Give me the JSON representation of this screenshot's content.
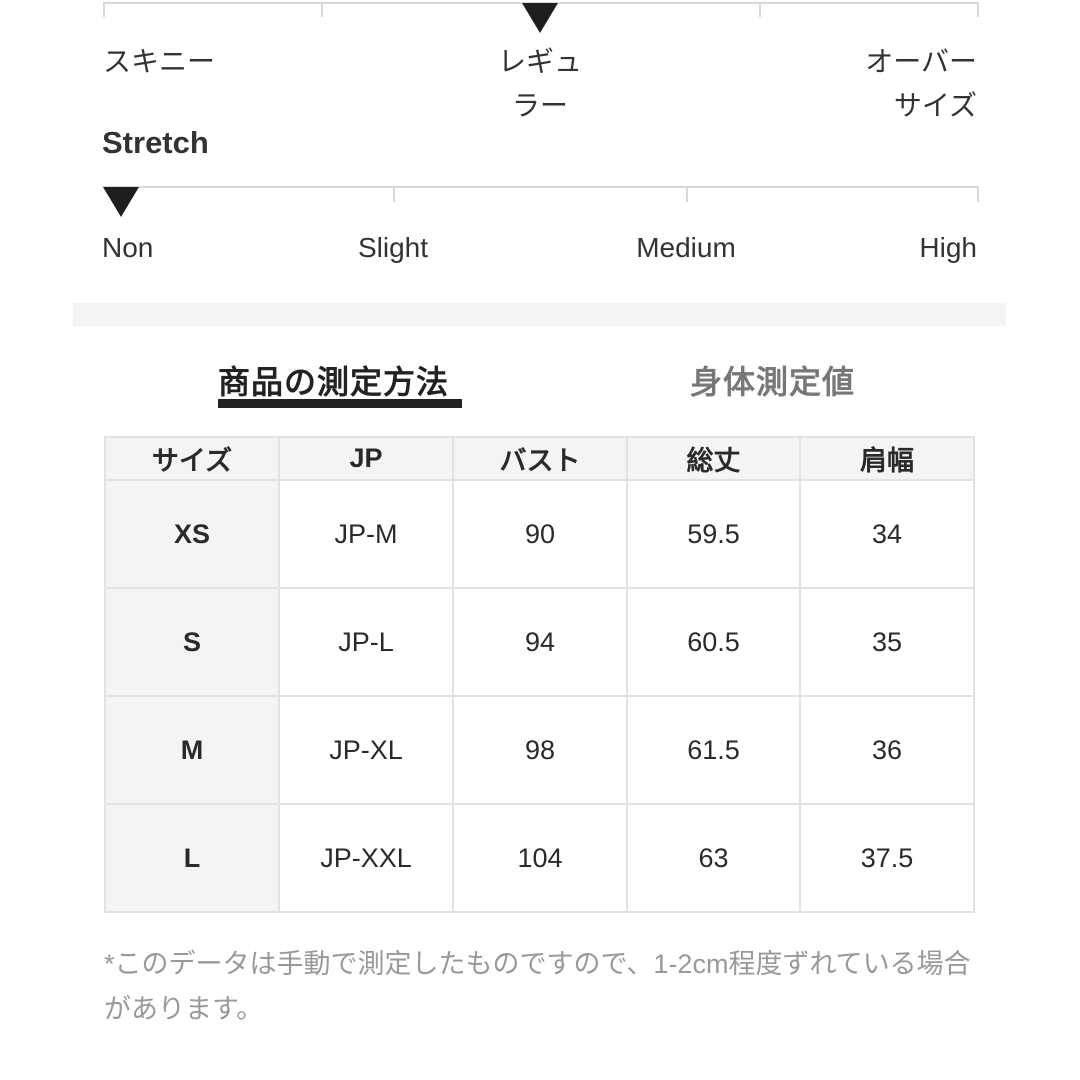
{
  "fit_scale": {
    "labels": [
      "スキニー",
      "レギュラー",
      "オーバーサイズ"
    ],
    "label_lines": [
      [
        "スキニー"
      ],
      [
        "レギュ",
        "ラー"
      ],
      [
        "オーバー",
        "サイズ"
      ]
    ],
    "selected_index": 1
  },
  "stretch_scale": {
    "title": "Stretch",
    "labels": [
      "Non",
      "Slight",
      "Medium",
      "High"
    ],
    "selected_index": 0
  },
  "tabs": [
    {
      "label": "商品の測定方法",
      "active": true
    },
    {
      "label": "身体測定値",
      "active": false
    }
  ],
  "size_table": {
    "headers": [
      "サイズ",
      "JP",
      "バスト",
      "総丈",
      "肩幅"
    ],
    "rows": [
      [
        "XS",
        "JP-M",
        "90",
        "59.5",
        "34"
      ],
      [
        "S",
        "JP-L",
        "94",
        "60.5",
        "35"
      ],
      [
        "M",
        "JP-XL",
        "98",
        "61.5",
        "36"
      ],
      [
        "L",
        "JP-XXL",
        "104",
        "63",
        "37.5"
      ]
    ]
  },
  "note": "*このデータは手動で測定したものですので、1-2cm程度ずれている場合があります。"
}
